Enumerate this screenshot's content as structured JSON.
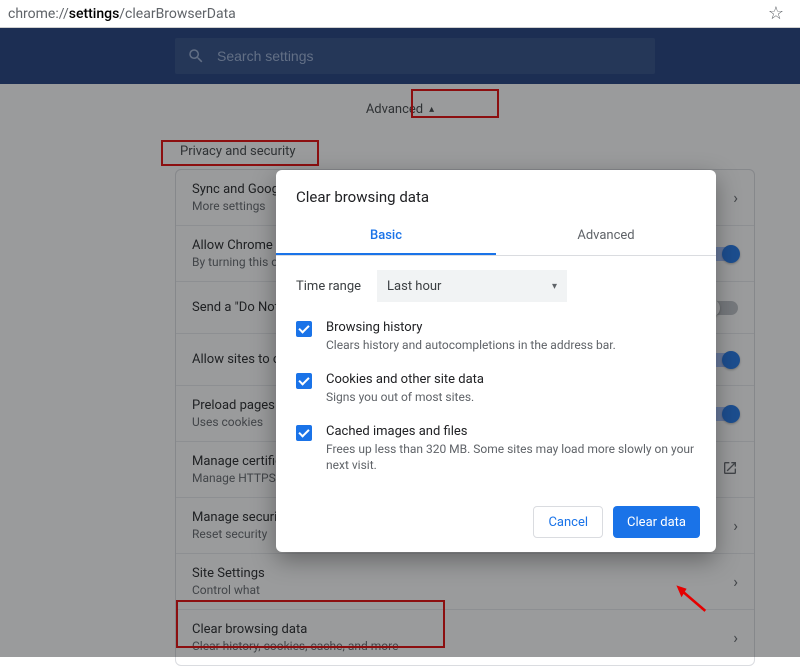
{
  "omnibox": {
    "prefix": "chrome://",
    "bold": "settings",
    "suffix": "/clearBrowserData"
  },
  "search": {
    "placeholder": "Search settings"
  },
  "advanced_label": "Advanced",
  "section_header": "Privacy and security",
  "rows": [
    {
      "title": "Sync and Google services",
      "sub": "More settings",
      "right": "arrow"
    },
    {
      "title": "Allow Chrome sign-in",
      "sub": "By turning this off",
      "right": "toggle_on"
    },
    {
      "title": "Send a \"Do Not Track\" request",
      "sub": "",
      "right": "toggle_off"
    },
    {
      "title": "Allow sites to check if you have payment methods",
      "sub": "",
      "right": "toggle_on"
    },
    {
      "title": "Preload pages for faster browsing",
      "sub": "Uses cookies",
      "right": "toggle_on"
    },
    {
      "title": "Manage certificates",
      "sub": "Manage HTTPS/SSL",
      "right": "external"
    },
    {
      "title": "Manage security keys",
      "sub": "Reset security",
      "right": "arrow"
    },
    {
      "title": "Site Settings",
      "sub": "Control what",
      "right": "arrow"
    },
    {
      "title": "Clear browsing data",
      "sub": "Clear history, cookies, cache, and more",
      "right": "arrow"
    }
  ],
  "dialog": {
    "title": "Clear browsing data",
    "tabs": {
      "basic": "Basic",
      "advanced": "Advanced"
    },
    "time_label": "Time range",
    "time_value": "Last hour",
    "options": [
      {
        "title": "Browsing history",
        "sub": "Clears history and autocompletions in the address bar."
      },
      {
        "title": "Cookies and other site data",
        "sub": "Signs you out of most sites."
      },
      {
        "title": "Cached images and files",
        "sub": "Frees up less than 320 MB. Some sites may load more slowly on your next visit."
      }
    ],
    "cancel": "Cancel",
    "clear": "Clear data"
  }
}
